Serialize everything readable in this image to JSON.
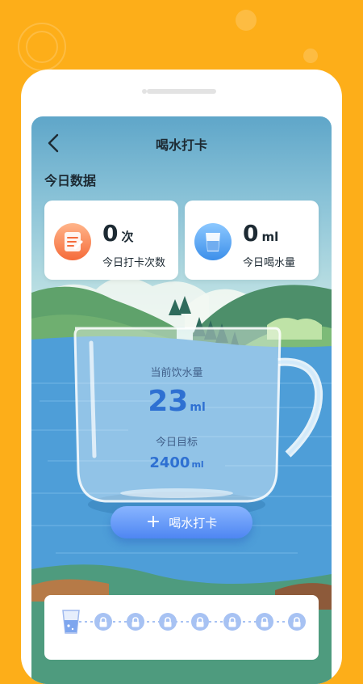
{
  "header": {
    "title": "喝水打卡",
    "back_icon": "chevron-left-icon"
  },
  "section": {
    "title": "今日数据"
  },
  "stats": [
    {
      "value": "0",
      "unit": "次",
      "label": "今日打卡次数",
      "icon": "checklist-icon"
    },
    {
      "value": "0",
      "unit": "ml",
      "label": "今日喝水量",
      "icon": "water-glass-icon"
    }
  ],
  "cup": {
    "current_label": "当前饮水量",
    "current_value": "23",
    "current_unit": "ml",
    "goal_label": "今日目标",
    "goal_value": "2400",
    "goal_unit": "ml"
  },
  "checkin_button": {
    "label": "喝水打卡",
    "icon": "plus-icon"
  },
  "progress": {
    "steps_total": 8,
    "steps_done": 1,
    "locked_icon": "lock-icon",
    "done_icon": "cup-icon"
  },
  "colors": {
    "background": "#FDAE19",
    "accent": "#4E86F2",
    "value_blue": "#2E70D2"
  }
}
